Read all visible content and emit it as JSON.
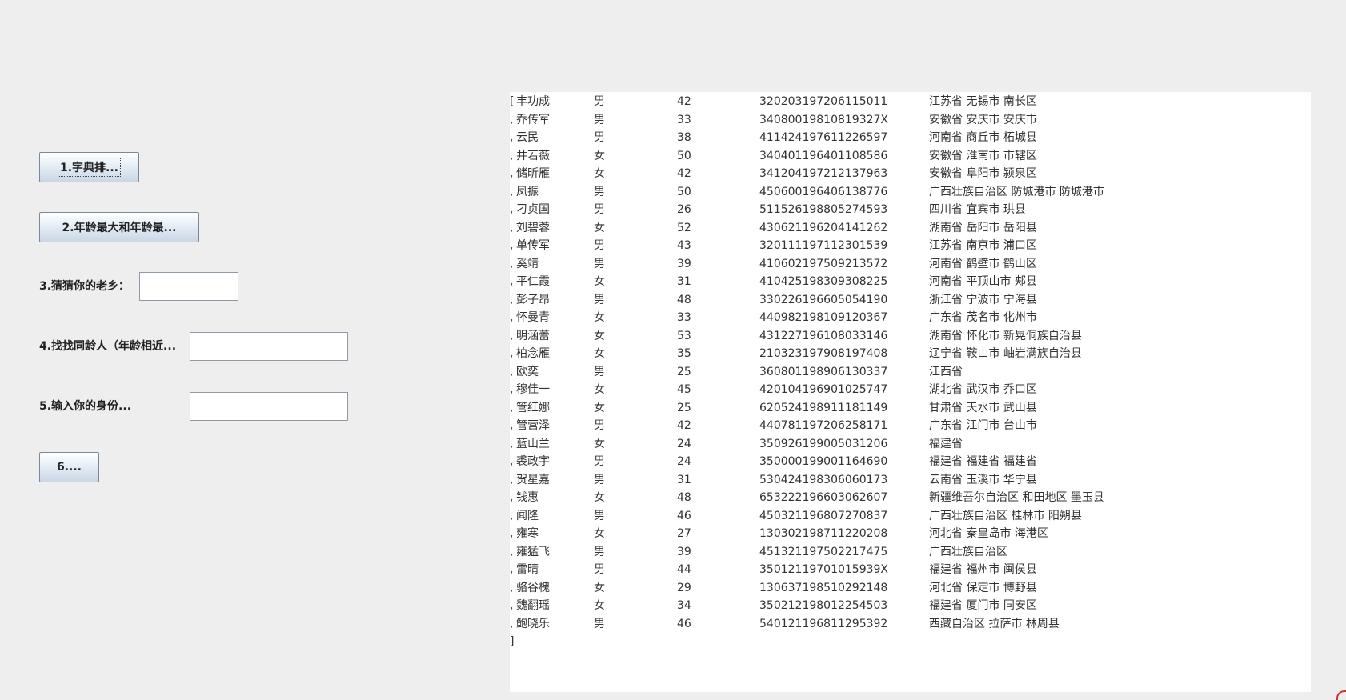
{
  "buttons": {
    "b1": "1.字典排...",
    "b2": "2.年龄最大和年龄最...",
    "b6": "6...."
  },
  "labels": {
    "l3": "3.猜猜你的老乡：",
    "l4": "4.找找同龄人（年龄相近...",
    "l5": "5.输入你的身份..."
  },
  "fields": {
    "f3": "",
    "f4": "",
    "f5": ""
  },
  "output": {
    "closing": "]",
    "rows": [
      {
        "prefix": "[",
        "name": "丰功成",
        "sex": "男",
        "age": "42",
        "id": "320203197206115011",
        "addr": "江苏省 无锡市 南长区"
      },
      {
        "prefix": ", ",
        "name": "乔传军",
        "sex": "男",
        "age": "33",
        "id": "34080019810819327X",
        "addr": "安徽省 安庆市 安庆市"
      },
      {
        "prefix": ", ",
        "name": "云民",
        "sex": "男",
        "age": "38",
        "id": "411424197611226597",
        "addr": "河南省 商丘市 柘城县"
      },
      {
        "prefix": ", ",
        "name": "井若薇",
        "sex": "女",
        "age": "50",
        "id": "340401196401108586",
        "addr": "安徽省 淮南市 市辖区"
      },
      {
        "prefix": ", ",
        "name": "储昕雁",
        "sex": "女",
        "age": "42",
        "id": "341204197212137963",
        "addr": "安徽省 阜阳市 颍泉区"
      },
      {
        "prefix": ", ",
        "name": "凤振",
        "sex": "男",
        "age": "50",
        "id": "450600196406138776",
        "addr": "广西壮族自治区 防城港市 防城港市"
      },
      {
        "prefix": ", ",
        "name": "刁贞国",
        "sex": "男",
        "age": "26",
        "id": "511526198805274593",
        "addr": "四川省 宜宾市 珙县"
      },
      {
        "prefix": ", ",
        "name": "刘碧蓉",
        "sex": "女",
        "age": "52",
        "id": "430621196204141262",
        "addr": "湖南省 岳阳市 岳阳县"
      },
      {
        "prefix": ", ",
        "name": "单传军",
        "sex": "男",
        "age": "43",
        "id": "320111197112301539",
        "addr": "江苏省 南京市 浦口区"
      },
      {
        "prefix": ", ",
        "name": "奚靖",
        "sex": "男",
        "age": "39",
        "id": "410602197509213572",
        "addr": "河南省 鹤壁市 鹤山区"
      },
      {
        "prefix": ", ",
        "name": "平仁霞",
        "sex": "女",
        "age": "31",
        "id": "410425198309308225",
        "addr": "河南省 平顶山市 郏县"
      },
      {
        "prefix": ", ",
        "name": "彭子昂",
        "sex": "男",
        "age": "48",
        "id": "330226196605054190",
        "addr": "浙江省 宁波市 宁海县"
      },
      {
        "prefix": ", ",
        "name": "怀曼青",
        "sex": "女",
        "age": "33",
        "id": "440982198109120367",
        "addr": "广东省 茂名市 化州市"
      },
      {
        "prefix": ", ",
        "name": "明涵蕾",
        "sex": "女",
        "age": "53",
        "id": "431227196108033146",
        "addr": "湖南省 怀化市 新晃侗族自治县"
      },
      {
        "prefix": ", ",
        "name": "柏念雁",
        "sex": "女",
        "age": "35",
        "id": "210323197908197408",
        "addr": "辽宁省 鞍山市 岫岩满族自治县"
      },
      {
        "prefix": ", ",
        "name": "欧奕",
        "sex": "男",
        "age": "25",
        "id": "360801198906130337",
        "addr": "江西省"
      },
      {
        "prefix": ", ",
        "name": "穆佳一",
        "sex": "女",
        "age": "45",
        "id": "420104196901025747",
        "addr": "湖北省 武汉市 乔口区"
      },
      {
        "prefix": ", ",
        "name": "管红娜",
        "sex": "女",
        "age": "25",
        "id": "620524198911181149",
        "addr": "甘肃省 天水市 武山县"
      },
      {
        "prefix": ", ",
        "name": "管营泽",
        "sex": "男",
        "age": "42",
        "id": "440781197206258171",
        "addr": "广东省 江门市 台山市"
      },
      {
        "prefix": ", ",
        "name": "蓝山兰",
        "sex": "女",
        "age": "24",
        "id": "350926199005031206",
        "addr": "福建省"
      },
      {
        "prefix": ", ",
        "name": "裘政宇",
        "sex": "男",
        "age": "24",
        "id": "350000199001164690",
        "addr": "福建省 福建省 福建省"
      },
      {
        "prefix": ", ",
        "name": "贺星嘉",
        "sex": "男",
        "age": "31",
        "id": "530424198306060173",
        "addr": "云南省 玉溪市 华宁县"
      },
      {
        "prefix": ", ",
        "name": "钱惠",
        "sex": "女",
        "age": "48",
        "id": "653222196603062607",
        "addr": "新疆维吾尔自治区 和田地区 墨玉县"
      },
      {
        "prefix": ", ",
        "name": "闻隆",
        "sex": "男",
        "age": "46",
        "id": "450321196807270837",
        "addr": "广西壮族自治区 桂林市 阳朔县"
      },
      {
        "prefix": ", ",
        "name": "雍寒",
        "sex": "女",
        "age": "27",
        "id": "130302198711220208",
        "addr": "河北省 秦皇岛市 海港区"
      },
      {
        "prefix": ", ",
        "name": "雍猛飞",
        "sex": "男",
        "age": "39",
        "id": "451321197502217475",
        "addr": "广西壮族自治区"
      },
      {
        "prefix": ", ",
        "name": "雷晴",
        "sex": "男",
        "age": "44",
        "id": "35012119701015939X",
        "addr": "福建省 福州市 闽侯县"
      },
      {
        "prefix": ", ",
        "name": "骆谷槐",
        "sex": "女",
        "age": "29",
        "id": "130637198510292148",
        "addr": "河北省 保定市 博野县"
      },
      {
        "prefix": ", ",
        "name": "魏翻瑶",
        "sex": "女",
        "age": "34",
        "id": "350212198012254503",
        "addr": "福建省 厦门市 同安区"
      },
      {
        "prefix": ", ",
        "name": "鲍晓乐",
        "sex": "男",
        "age": "46",
        "id": "540121196811295392",
        "addr": "西藏自治区 拉萨市 林周县"
      }
    ]
  }
}
